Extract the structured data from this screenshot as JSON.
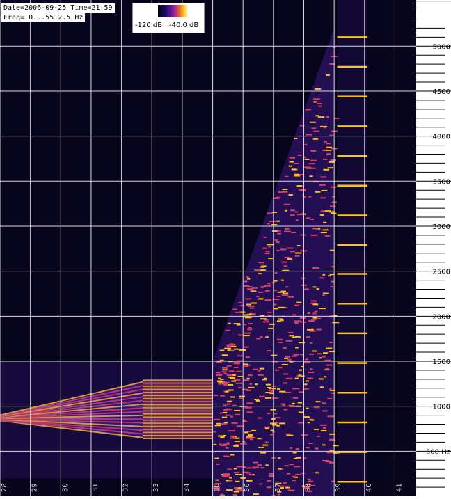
{
  "info": {
    "date_line": "Date=2006-09-25 Time=21:59",
    "freq_line": "Freq= 0...5512.5 Hz"
  },
  "legend": {
    "min_label": "-120 dB",
    "max_label": "-40.0 dB",
    "colors": [
      "#000010",
      "#1a0a6a",
      "#7a1aa0",
      "#e0504a",
      "#ffc020",
      "#fff5a0"
    ]
  },
  "colors": {
    "background": "#06051c",
    "grid": "#d8d8d8",
    "signal_low": "#4a1a9a",
    "signal_mid": "#d8406a",
    "signal_high": "#ffc21a"
  },
  "chart_data": {
    "type": "heatmap",
    "title": "",
    "xlabel": "",
    "ylabel": "",
    "xlim": [
      28,
      41.7
    ],
    "ylim": [
      0,
      5512.5
    ],
    "x_ticks": [
      "28",
      "29",
      "30",
      "31",
      "32",
      "33",
      "34",
      "35",
      "36",
      "37",
      "38",
      "39",
      "40",
      "41"
    ],
    "y_ticks": [
      {
        "value": 500,
        "label": "500 Hz"
      },
      {
        "value": 1000,
        "label": "1000"
      },
      {
        "value": 1500,
        "label": "1500"
      },
      {
        "value": 2000,
        "label": "2000"
      },
      {
        "value": 2500,
        "label": "2500"
      },
      {
        "value": 3000,
        "label": "3000"
      },
      {
        "value": 3500,
        "label": "3500"
      },
      {
        "value": 4000,
        "label": "4000"
      },
      {
        "value": 4500,
        "label": "4500"
      },
      {
        "value": 5000,
        "label": "5000"
      }
    ],
    "grid": true,
    "colorbar": {
      "min_db": -120,
      "max_db": -40
    },
    "features": [
      {
        "name": "converging-band",
        "x_start": 28,
        "x_end": 32.7,
        "f_low_start": 870,
        "f_high_start": 870,
        "f_low_end": 650,
        "f_high_end": 1270
      },
      {
        "name": "stable-band",
        "x_start": 32.7,
        "x_end": 35,
        "f_low": 640,
        "f_high": 1290
      },
      {
        "name": "broadband-region",
        "x_start": 35,
        "x_end": 39,
        "f_max_start": 1500,
        "f_max_end": 5200
      },
      {
        "name": "harmonic-lines",
        "x_start": 39.1,
        "x_end": 40.1,
        "frequencies": [
          160,
          490,
          820,
          1150,
          1480,
          1810,
          2140,
          2470,
          2790,
          3120,
          3450,
          3780,
          4110,
          4440,
          4770,
          5100
        ]
      }
    ]
  }
}
